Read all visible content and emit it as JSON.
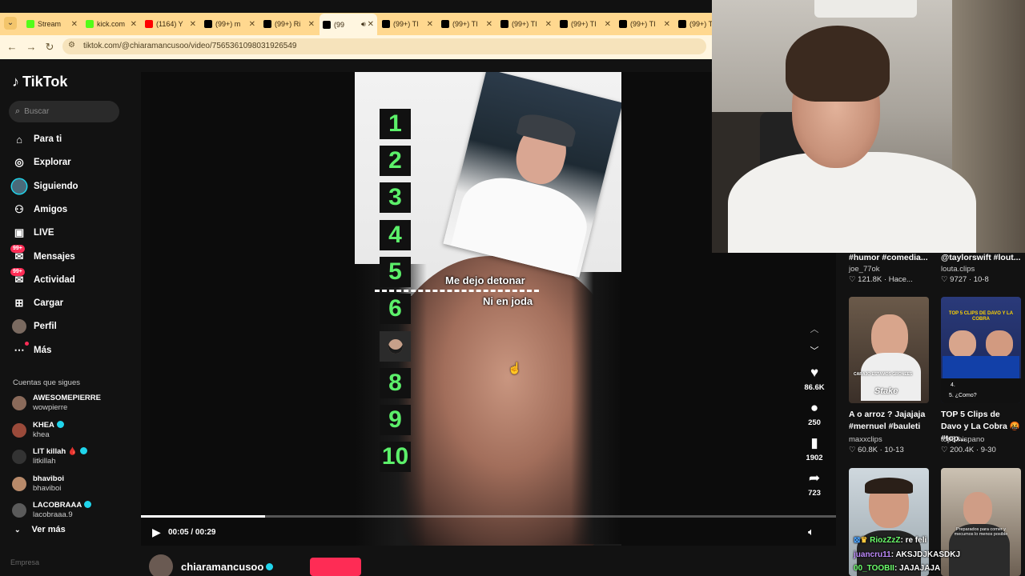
{
  "browser": {
    "tabs": [
      {
        "label": "Stream",
        "favicon_color": "#53fc18"
      },
      {
        "label": "kick.com",
        "favicon_color": "#53fc18"
      },
      {
        "label": "(1164) Y",
        "favicon_color": "#ff0000"
      },
      {
        "label": "(99+) m",
        "favicon_color": "#000000"
      },
      {
        "label": "(99+) Ri",
        "favicon_color": "#000000"
      },
      {
        "label": "(99",
        "favicon_color": "#000000",
        "active": true
      },
      {
        "label": "(99+) TI",
        "favicon_color": "#000000"
      },
      {
        "label": "(99+) TI",
        "favicon_color": "#000000"
      },
      {
        "label": "(99+) TI",
        "favicon_color": "#000000"
      },
      {
        "label": "(99+) TI",
        "favicon_color": "#000000"
      },
      {
        "label": "(99+) TI",
        "favicon_color": "#000000"
      },
      {
        "label": "(99+) TI",
        "favicon_color": "#000000"
      }
    ],
    "url": "tiktok.com/@chiaramancusoo/video/7565361098031926549"
  },
  "sidebar": {
    "logo": "TikTok",
    "search_placeholder": "Buscar",
    "nav": [
      {
        "label": "Para ti",
        "icon": "home-icon"
      },
      {
        "label": "Explorar",
        "icon": "compass-icon"
      },
      {
        "label": "Siguiendo",
        "icon": "following-avatar-icon"
      },
      {
        "label": "Amigos",
        "icon": "friends-icon"
      },
      {
        "label": "LIVE",
        "icon": "live-tv-icon"
      },
      {
        "label": "Mensajes",
        "icon": "messages-icon",
        "badge": "99+"
      },
      {
        "label": "Actividad",
        "icon": "activity-icon",
        "badge": "99+"
      },
      {
        "label": "Cargar",
        "icon": "upload-icon"
      },
      {
        "label": "Perfil",
        "icon": "profile-avatar-icon"
      },
      {
        "label": "Más",
        "icon": "more-icon"
      }
    ],
    "following_title": "Cuentas que sigues",
    "following": [
      {
        "name": "AWESOMEPIERRE",
        "handle": "wowpierre",
        "verified": false,
        "avatar_color": "#8a6a5a"
      },
      {
        "name": "KHEA",
        "handle": "khea",
        "verified": true,
        "avatar_color": "#9a4a3a"
      },
      {
        "name": "LIT killah 🩸",
        "handle": "litkillah",
        "verified": true,
        "avatar_color": "#333333"
      },
      {
        "name": "bhaviboi",
        "handle": "bhaviboi",
        "verified": false,
        "avatar_color": "#b88a6a"
      },
      {
        "name": "LACOBRAAA",
        "handle": "lacobraaa.9",
        "verified": true,
        "avatar_color": "#5a5a5a"
      }
    ],
    "see_more": "Ver más",
    "footer_cut": "Empresa"
  },
  "player": {
    "numbers": [
      "1",
      "2",
      "3",
      "4",
      "5",
      "6",
      "8",
      "9",
      "10"
    ],
    "caption_1": "Me dejo detonar",
    "caption_2": "Ni en joda",
    "progress": 0.178,
    "time": "00:05 / 00:29",
    "author": "chiaramancusoo",
    "actions": {
      "likes": "86.6K",
      "comments": "250",
      "saves": "1902",
      "shares": "723"
    }
  },
  "feed": {
    "top_row": [
      {
        "title": "#humor #comedia...",
        "author": "joe_77ok",
        "stats": "♡ 121.8K · Hace..."
      },
      {
        "title": "@taylorswift #lout...",
        "author": "louta.clips",
        "stats": "♡ 9727 · 10-8"
      }
    ],
    "cards": [
      {
        "title": "A o arroz ? Jajajaja #mernuel #bauleti",
        "author": "maxxclips",
        "stats": "♡ 60.8K · 10-13",
        "thumb_text": "CARAJO ESTAMOS GRONEES",
        "brand": "Stake"
      },
      {
        "title": "TOP 5 Clips de Davo y La Cobra 🤬 #top...",
        "author": "top5.hispano",
        "stats": "♡ 200.4K · 9-30",
        "thumb_text": "TOP 5 CLIPS DE DAVO Y LA COBRA",
        "thumb_small_1": "4.",
        "thumb_small_2": "5. ¿Como?"
      }
    ],
    "bottom_thumb_text": "Preparados para comer y mecumos lo menos posible"
  },
  "chat": [
    {
      "user": "RiozZzZ",
      "msg": ": re feli",
      "color": "#6cff6c"
    },
    {
      "user": "juancru11",
      "msg": ": AKSJDJKASDKJ",
      "color": "#c08cff"
    },
    {
      "user": "00_TOOBII",
      "msg": ": JAJAJAJA",
      "color": "#6cff6c"
    }
  ]
}
